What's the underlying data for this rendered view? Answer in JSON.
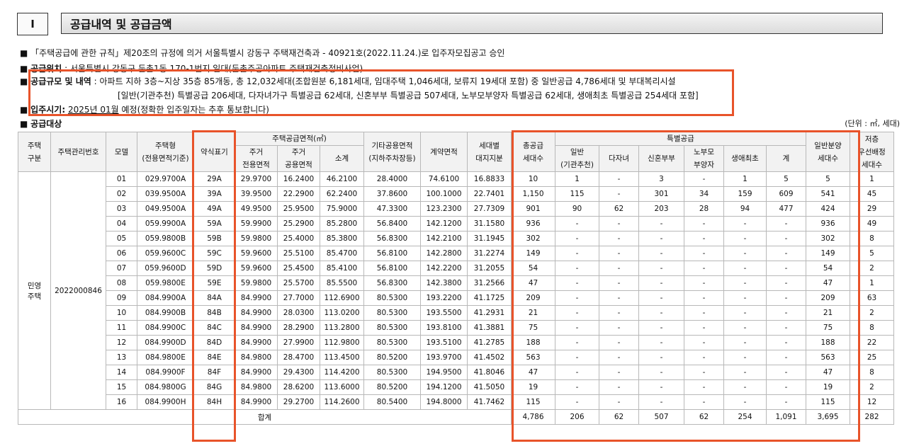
{
  "section": {
    "num": "I",
    "title": "공급내역 및 공급금액"
  },
  "lines": {
    "l1": "■ 「주택공급에 관한 규칙」제20조의 규정에 의거 서울특별시 강동구 주택재건축과 - 40921호(2022.11.24.)로 입주자모집공고 승인",
    "l2_b": "공급위치",
    "l2": " : 서울특별시 강동구 둔촌1동 170-1번지 일대(둔촌주공아파트 주택재건축정비사업)",
    "l3_b": "공급규모 및 내역",
    "l3": " : 아파트 지하 3층~지상 35층 85개동, 총 12,032세대(조합원분 6,181세대, 임대주택 1,046세대, 보류지 19세대 포함) 중 일반공급 4,786세대 및 부대복리시설",
    "l3b": "[일반(기관추천) 특별공급 206세대, 다자녀가구 특별공급 62세대, 신혼부부 특별공급 507세대, 노부모부양자 특별공급 62세대, 생애최초 특별공급 254세대 포함]",
    "l4_b": "입주시기:",
    "l4_u": "2025년 01월",
    "l4": " 예정(정확한 입주일자는 추후 통보합니다)",
    "l5": "공급대상",
    "bullet": "■",
    "unit": "(단위 : ㎡, 세대)"
  },
  "headers": {
    "type": "주택\n구분",
    "mgmt": "주택관리번호",
    "model": "모델",
    "htype": "주택형\n(전용면적기준)",
    "abbr": "약식표기",
    "area": "주택공급면적(㎡)",
    "area_excl": "주거\n전용면적",
    "area_common": "주거\n공용면적",
    "area_sub": "소계",
    "other": "기타공용면적\n(지하주차장등)",
    "contract": "계약면적",
    "land": "세대별\n대지지분",
    "total": "총공급\n세대수",
    "special": "특별공급",
    "sp_inst": "일반\n(기관추천)",
    "sp_multi": "다자녀",
    "sp_newly": "신혼부부",
    "sp_parent": "노부모\n부양자",
    "sp_first": "생애최초",
    "sp_sum": "계",
    "general": "일반분양\n세대수",
    "low": "저층\n우선배정\n세대수"
  },
  "rows_meta": {
    "type": "민영\n주택",
    "mgmt": "2022000846"
  },
  "rows": [
    [
      "01",
      "029.9700A",
      "29A",
      "29.9700",
      "16.2400",
      "46.2100",
      "28.4000",
      "74.6100",
      "16.8833",
      "10",
      "1",
      "-",
      "3",
      "-",
      "1",
      "5",
      "5",
      "1"
    ],
    [
      "02",
      "039.9500A",
      "39A",
      "39.9500",
      "22.2900",
      "62.2400",
      "37.8600",
      "100.1000",
      "22.7401",
      "1,150",
      "115",
      "-",
      "301",
      "34",
      "159",
      "609",
      "541",
      "45"
    ],
    [
      "03",
      "049.9500A",
      "49A",
      "49.9500",
      "25.9500",
      "75.9000",
      "47.3300",
      "123.2300",
      "27.7309",
      "901",
      "90",
      "62",
      "203",
      "28",
      "94",
      "477",
      "424",
      "29"
    ],
    [
      "04",
      "059.9900A",
      "59A",
      "59.9900",
      "25.2900",
      "85.2800",
      "56.8400",
      "142.1200",
      "31.1580",
      "936",
      "-",
      "-",
      "-",
      "-",
      "-",
      "-",
      "936",
      "49"
    ],
    [
      "05",
      "059.9800B",
      "59B",
      "59.9800",
      "25.4000",
      "85.3800",
      "56.8300",
      "142.2100",
      "31.1945",
      "302",
      "-",
      "-",
      "-",
      "-",
      "-",
      "-",
      "302",
      "8"
    ],
    [
      "06",
      "059.9600C",
      "59C",
      "59.9600",
      "25.5100",
      "85.4700",
      "56.8100",
      "142.2800",
      "31.2274",
      "149",
      "-",
      "-",
      "-",
      "-",
      "-",
      "-",
      "149",
      "5"
    ],
    [
      "07",
      "059.9600D",
      "59D",
      "59.9600",
      "25.4500",
      "85.4100",
      "56.8100",
      "142.2200",
      "31.2055",
      "54",
      "-",
      "-",
      "-",
      "-",
      "-",
      "-",
      "54",
      "2"
    ],
    [
      "08",
      "059.9800E",
      "59E",
      "59.9800",
      "25.5700",
      "85.5500",
      "56.8300",
      "142.3800",
      "31.2566",
      "47",
      "-",
      "-",
      "-",
      "-",
      "-",
      "-",
      "47",
      "1"
    ],
    [
      "09",
      "084.9900A",
      "84A",
      "84.9900",
      "27.7000",
      "112.6900",
      "80.5300",
      "193.2200",
      "41.1725",
      "209",
      "-",
      "-",
      "-",
      "-",
      "-",
      "-",
      "209",
      "63"
    ],
    [
      "10",
      "084.9900B",
      "84B",
      "84.9900",
      "28.0300",
      "113.0200",
      "80.5300",
      "193.5500",
      "41.2931",
      "21",
      "-",
      "-",
      "-",
      "-",
      "-",
      "-",
      "21",
      "2"
    ],
    [
      "11",
      "084.9900C",
      "84C",
      "84.9900",
      "28.2900",
      "113.2800",
      "80.5300",
      "193.8100",
      "41.3881",
      "75",
      "-",
      "-",
      "-",
      "-",
      "-",
      "-",
      "75",
      "8"
    ],
    [
      "12",
      "084.9900D",
      "84D",
      "84.9900",
      "27.9900",
      "112.9800",
      "80.5300",
      "193.5100",
      "41.2785",
      "188",
      "-",
      "-",
      "-",
      "-",
      "-",
      "-",
      "188",
      "22"
    ],
    [
      "13",
      "084.9800E",
      "84E",
      "84.9800",
      "28.4700",
      "113.4500",
      "80.5200",
      "193.9700",
      "41.4502",
      "563",
      "-",
      "-",
      "-",
      "-",
      "-",
      "-",
      "563",
      "25"
    ],
    [
      "14",
      "084.9900F",
      "84F",
      "84.9900",
      "29.4300",
      "114.4200",
      "80.5300",
      "194.9500",
      "41.8046",
      "47",
      "-",
      "-",
      "-",
      "-",
      "-",
      "-",
      "47",
      "8"
    ],
    [
      "15",
      "084.9800G",
      "84G",
      "84.9800",
      "28.6200",
      "113.6000",
      "80.5200",
      "194.1200",
      "41.5050",
      "19",
      "-",
      "-",
      "-",
      "-",
      "-",
      "-",
      "19",
      "2"
    ],
    [
      "16",
      "084.9900H",
      "84H",
      "84.9900",
      "29.2700",
      "114.2600",
      "80.5400",
      "194.8000",
      "41.7462",
      "115",
      "-",
      "-",
      "-",
      "-",
      "-",
      "-",
      "115",
      "12"
    ]
  ],
  "total": {
    "label": "합계",
    "values": [
      "4,786",
      "206",
      "62",
      "507",
      "62",
      "254",
      "1,091",
      "3,695",
      "282"
    ]
  },
  "colors": {
    "highlight": "#e8532a",
    "header_bg": "#f2f2f2",
    "border": "#b8b8b8"
  }
}
